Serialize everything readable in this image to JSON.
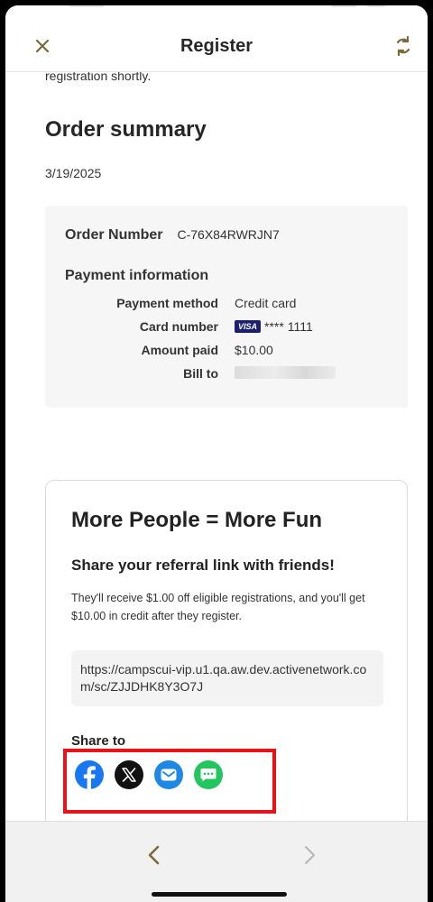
{
  "header": {
    "title": "Register",
    "close_icon": "close-icon",
    "refresh_icon": "refresh-icon"
  },
  "cutoff_text": "registration shortly.",
  "order": {
    "title": "Order summary",
    "date": "3/19/2025",
    "number_label": "Order Number",
    "number_value": "C-76X84RWRJN7",
    "payment_title": "Payment information",
    "rows": [
      {
        "label": "Payment method",
        "value": "Credit card"
      },
      {
        "label": "Card number",
        "card_brand": "VISA",
        "value": "**** 1111"
      },
      {
        "label": "Amount paid",
        "value": "$10.00"
      },
      {
        "label": "Bill to",
        "value": ""
      }
    ]
  },
  "referral": {
    "title": "More People = More Fun",
    "subtitle": "Share your referral link with friends!",
    "body": "They'll receive $1.00 off eligible registrations, and you'll get $10.00 in credit after they register.",
    "link": "https://campscui-vip.u1.qa.aw.dev.activenetwork.com/sc/ZJJDHK8Y3O7J",
    "share_label": "Share to",
    "share_icons": [
      "facebook-icon",
      "x-icon",
      "email-icon",
      "message-icon"
    ]
  },
  "colors": {
    "facebook": "#1877f2",
    "x": "#111111",
    "email": "#1e88e5",
    "message": "#22c55e",
    "highlight": "#e8121a",
    "header_icon": "#7a6a3a"
  },
  "nav": {
    "back_icon": "chevron-left-icon",
    "forward_icon": "chevron-right-icon"
  }
}
